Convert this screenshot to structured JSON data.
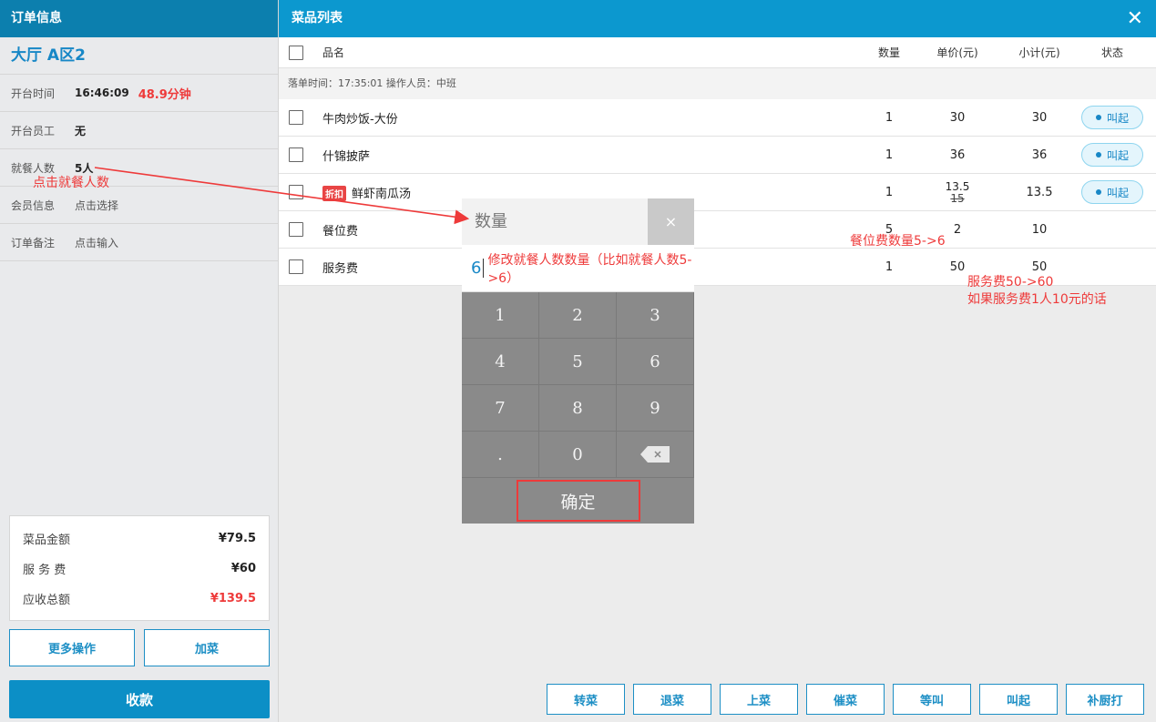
{
  "left": {
    "header": "订单信息",
    "table_name": "大厅 A区2",
    "open_time_label": "开台时间",
    "open_time": "16:46:09",
    "elapsed": "48.9分钟",
    "staff_label": "开台员工",
    "staff": "无",
    "guests_label": "就餐人数",
    "guests": "5人",
    "member_label": "会员信息",
    "member_action": "点击选择",
    "note_label": "订单备注",
    "note_action": "点击输入",
    "summary": {
      "dish_label": "菜品金额",
      "dish_amount": "¥79.5",
      "service_label": "服 务 费",
      "service_amount": "¥60",
      "total_label": "应收总额",
      "total_amount": "¥139.5"
    },
    "more_ops": "更多操作",
    "add_dish": "加菜",
    "pay": "收款"
  },
  "right": {
    "header": "菜品列表",
    "close_glyph": "✕",
    "columns": {
      "name": "品名",
      "qty": "数量",
      "price": "单价(元)",
      "subtotal": "小计(元)",
      "status": "状态"
    },
    "meta": "落单时间：17:35:01  操作人员：中班",
    "rows": [
      {
        "name": "牛肉炒饭-大份",
        "qty": "1",
        "price": "30",
        "subtotal": "30",
        "status": "叫起"
      },
      {
        "name": "什锦披萨",
        "qty": "1",
        "price": "36",
        "subtotal": "36",
        "status": "叫起"
      },
      {
        "tag": "折扣",
        "name": "鲜虾南瓜汤",
        "qty": "1",
        "price": "13.5",
        "price_old": "15",
        "subtotal": "13.5",
        "status": "叫起"
      },
      {
        "name": "餐位费",
        "qty": "5",
        "price": "2",
        "subtotal": "10"
      },
      {
        "name": "服务费",
        "qty": "1",
        "price": "50",
        "subtotal": "50"
      }
    ],
    "actions": [
      "转菜",
      "退菜",
      "上菜",
      "催菜",
      "等叫",
      "叫起",
      "补厨打"
    ]
  },
  "keypad": {
    "title": "数量",
    "close_glyph": "×",
    "value": "6",
    "note": "修改就餐人数数量（比如就餐人数5->6）",
    "keys": [
      "1",
      "2",
      "3",
      "4",
      "5",
      "6",
      "7",
      "8",
      "9",
      ".",
      "0"
    ],
    "confirm": "确定"
  },
  "annotations": {
    "click_guests": "点击就餐人数",
    "seat_fee": "餐位费数量5->6",
    "service_line1": "服务费50->60",
    "service_line2": "如果服务费1人10元的话"
  },
  "colors": {
    "primary": "#0c98cf",
    "accent_red": "#ee3a3a"
  }
}
